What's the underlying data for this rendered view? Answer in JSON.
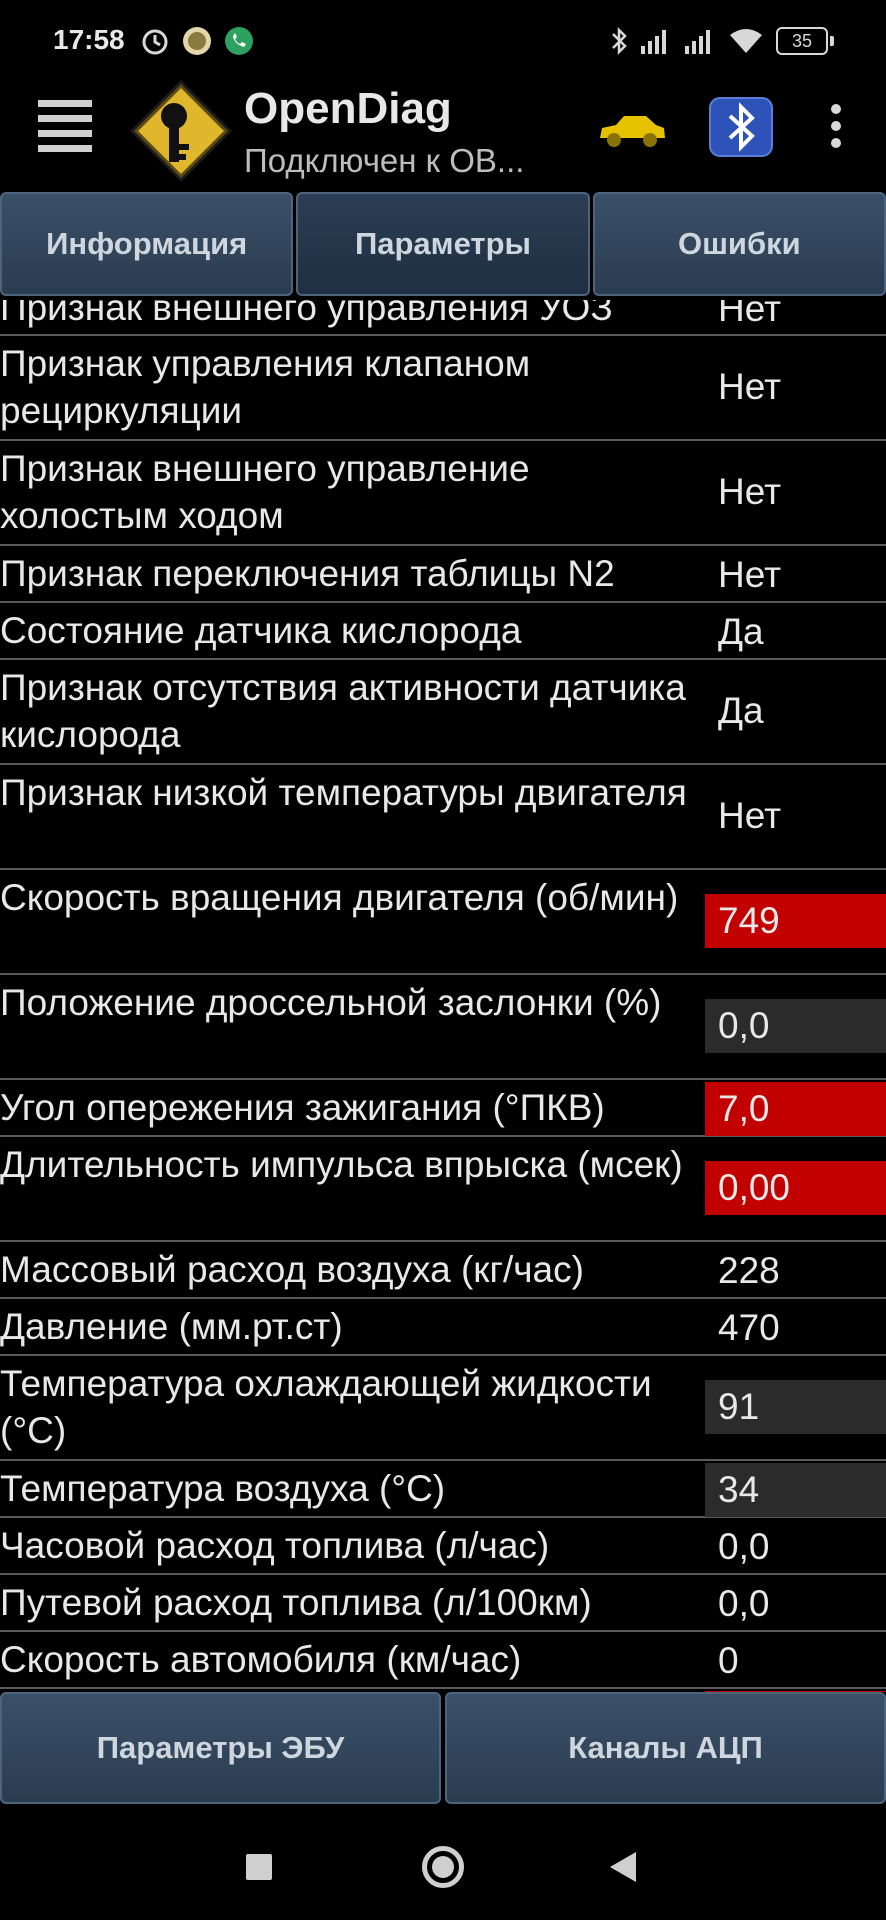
{
  "status_bar": {
    "time": "17:58",
    "battery": "35",
    "icons": [
      "alarm-icon",
      "rocket-app-icon",
      "phone-call-icon",
      "bluetooth-icon",
      "signal-icon",
      "signal-icon",
      "wifi-icon",
      "battery-icon"
    ]
  },
  "app": {
    "title": "OpenDiag",
    "subtitle": "Подключен к ОВ...",
    "logo_icon": "key-diamond-logo",
    "car_icon_color": "#e7c200"
  },
  "tabs": [
    {
      "label": "Информация"
    },
    {
      "label": "Параметры"
    },
    {
      "label": "Ошибки"
    }
  ],
  "params": [
    {
      "name": "Признак внешнего управления УОЗ",
      "value": "Нет",
      "style": "none"
    },
    {
      "name": "Признак управления клапаном рециркуляции",
      "value": "Нет",
      "style": "none"
    },
    {
      "name": "Признак внешнего управление холостым ходом",
      "value": "Нет",
      "style": "none"
    },
    {
      "name": "Признак переключения таблицы N2",
      "value": "Нет",
      "style": "none"
    },
    {
      "name": "Состояние датчика кислорода",
      "value": "Да",
      "style": "none"
    },
    {
      "name": "Признак отсутствия активности датчика кислорода",
      "value": "Да",
      "style": "none"
    },
    {
      "name": "Признак низкой температуры двигателя",
      "value": "Нет",
      "style": "none"
    },
    {
      "name": "Скорость вращения двигателя (об/мин)",
      "value": "749",
      "style": "red"
    },
    {
      "name": "Положение дроссельной заслонки (%)",
      "value": "0,0",
      "style": "gray"
    },
    {
      "name": "Угол опережения зажигания (°ПКВ)",
      "value": "7,0",
      "style": "red"
    },
    {
      "name": "Длительность импульса впрыска (мсек)",
      "value": "0,00",
      "style": "red"
    },
    {
      "name": "Массовый расход воздуха (кг/час)",
      "value": "228",
      "style": "none"
    },
    {
      "name": "Давление (мм.рт.ст)",
      "value": "470",
      "style": "none"
    },
    {
      "name": "Температура охлаждающей жидкости (°С)",
      "value": "91",
      "style": "gray"
    },
    {
      "name": "Температура воздуха (°С)",
      "value": "34",
      "style": "gray"
    },
    {
      "name": "Часовой расход топлива (л/час)",
      "value": "0,0",
      "style": "none"
    },
    {
      "name": "Путевой расход топлива (л/100км)",
      "value": "0,0",
      "style": "none"
    },
    {
      "name": "Скорость автомобиля (км/час)",
      "value": "0",
      "style": "none"
    }
  ],
  "bottom_buttons": [
    {
      "label": "Параметры ЭБУ"
    },
    {
      "label": "Каналы АЦП"
    }
  ],
  "colors": {
    "value_red": "#c20000",
    "value_gray": "#2b2b2b",
    "tab_bg": "#2f4358"
  }
}
